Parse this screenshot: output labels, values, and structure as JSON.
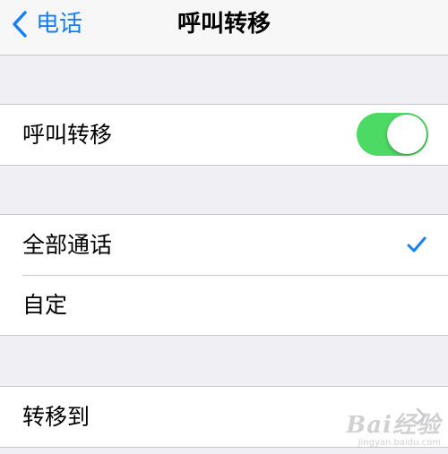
{
  "navbar": {
    "back_label": "电话",
    "title": "呼叫转移",
    "back_icon": "chevron-left-icon"
  },
  "forwarding": {
    "label": "呼叫转移",
    "toggle_on": true,
    "toggle_color": "#4cd964"
  },
  "call_options": {
    "items": [
      {
        "label": "全部通话",
        "selected": true
      },
      {
        "label": "自定",
        "selected": false
      }
    ],
    "check_icon": "checkmark-icon",
    "accent": "#157efb"
  },
  "forward_to": {
    "label": "转移到",
    "chevron_icon": "chevron-right-icon"
  },
  "watermark": {
    "brand": "Bai经验",
    "url": "jingyan.baidu.com"
  }
}
